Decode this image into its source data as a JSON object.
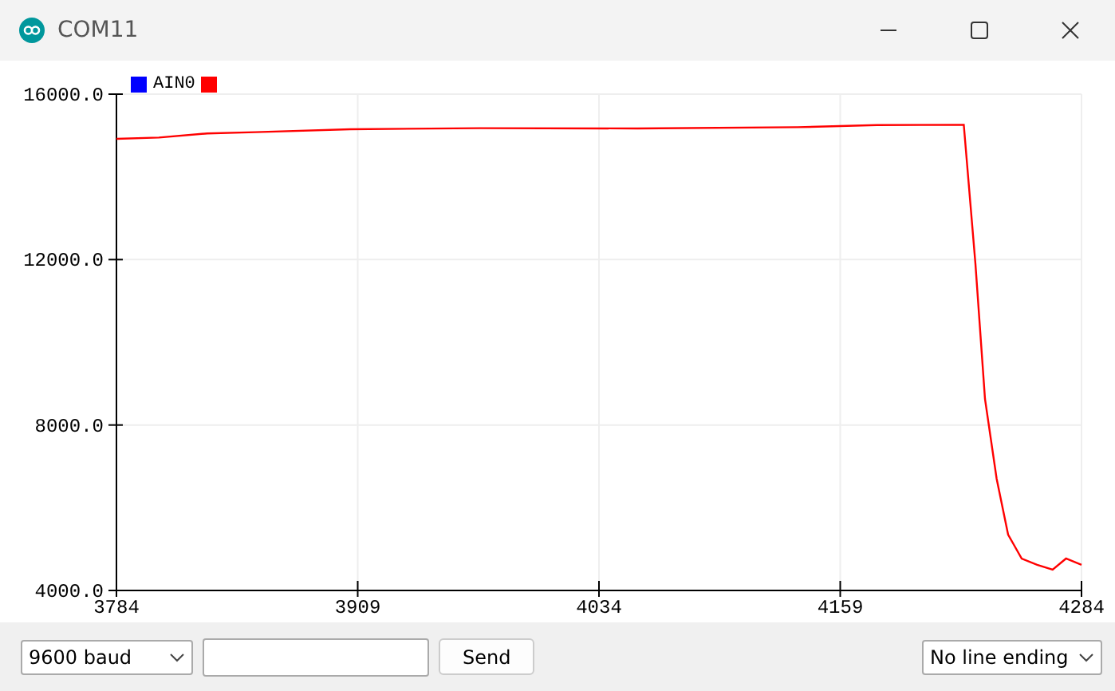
{
  "window": {
    "title": "COM11"
  },
  "plot": {
    "legend": [
      {
        "color": "#0000ff"
      }
    ],
    "chart_data": {
      "type": "line",
      "grid": true,
      "x": [
        3784,
        3806,
        3831,
        3856,
        3905,
        3972,
        4054,
        4137,
        4178,
        4223,
        4229,
        4234,
        4240,
        4246,
        4253,
        4261,
        4269,
        4276,
        4284
      ],
      "series": [
        {
          "name": "AIN0",
          "color": "#ff0000",
          "values": [
            14920,
            14950,
            15050,
            15080,
            15150,
            15180,
            15170,
            15200,
            15250,
            15260,
            11900,
            8630,
            6700,
            5350,
            4770,
            4620,
            4500,
            4770,
            4620
          ]
        }
      ],
      "xlim": [
        3784,
        4284
      ],
      "ylim": [
        4000,
        16000
      ],
      "xticks": [
        {
          "value": 3784,
          "label": "3784"
        },
        {
          "value": 3909,
          "label": "3909"
        },
        {
          "value": 4034,
          "label": "4034"
        },
        {
          "value": 4159,
          "label": "4159"
        },
        {
          "value": 4284,
          "label": "4284"
        }
      ],
      "yticks": [
        {
          "value": 4000,
          "label": "4000.0"
        },
        {
          "value": 8000,
          "label": "8000.0"
        },
        {
          "value": 12000,
          "label": "12000.0"
        },
        {
          "value": 16000,
          "label": "16000.0"
        }
      ]
    }
  },
  "footer": {
    "baud": "9600 baud",
    "send": "Send",
    "line_ending": "No line ending"
  }
}
